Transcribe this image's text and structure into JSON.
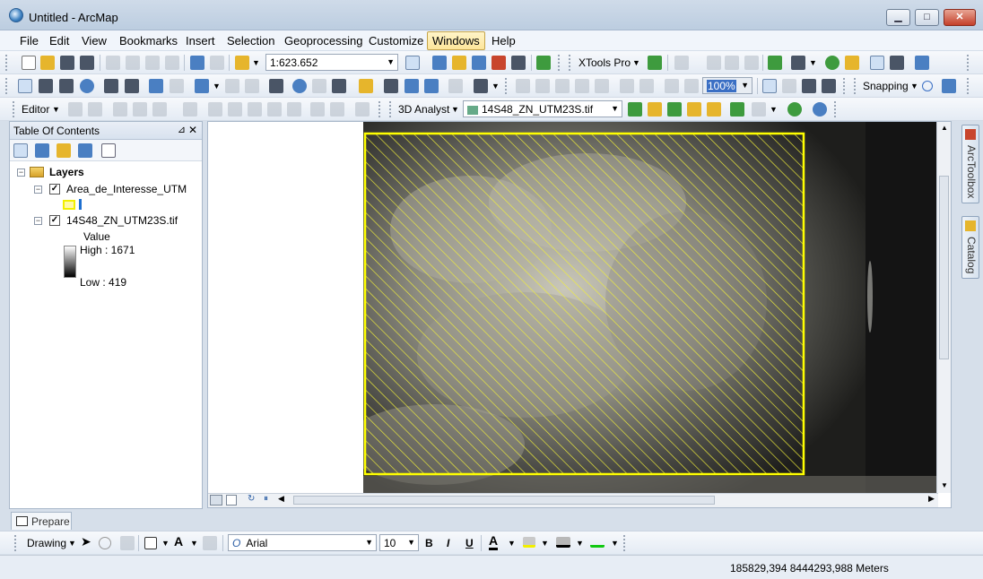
{
  "window": {
    "title": "Untitled - ArcMap",
    "min": "▁",
    "max": "□",
    "close": "✕"
  },
  "menu": [
    "File",
    "Edit",
    "View",
    "Bookmarks",
    "Insert",
    "Selection",
    "Geoprocessing",
    "Customize",
    "Windows",
    "Help"
  ],
  "menu_active": "Windows",
  "toolbar1": {
    "scale": "1:623.652",
    "xtools": "XTools Pro"
  },
  "toolbar2": {
    "zoom_percent": "100%",
    "snapping": "Snapping"
  },
  "toolbar3": {
    "editor": "Editor",
    "analyst": "3D Analyst",
    "layer_combo": "14S48_ZN_UTM23S.tif"
  },
  "toc": {
    "title": "Table Of Contents",
    "root": "Layers",
    "layer1": "Area_de_Interesse_UTM",
    "layer2": "14S48_ZN_UTM23S.tif",
    "value_label": "Value",
    "high": "High : 1671",
    "low": "Low : 419"
  },
  "side_tabs": [
    "ArcToolbox",
    "Catalog"
  ],
  "prepare_tab": "Prepare",
  "drawing": {
    "label": "Drawing",
    "font": "Arial",
    "size": "10",
    "bold": "B",
    "italic": "I",
    "underline": "U"
  },
  "status": {
    "coords": "185829,394  8444293,988 Meters"
  },
  "colors": {
    "aoi_outline": "#ffff00",
    "accent": "#3a7fc0"
  }
}
